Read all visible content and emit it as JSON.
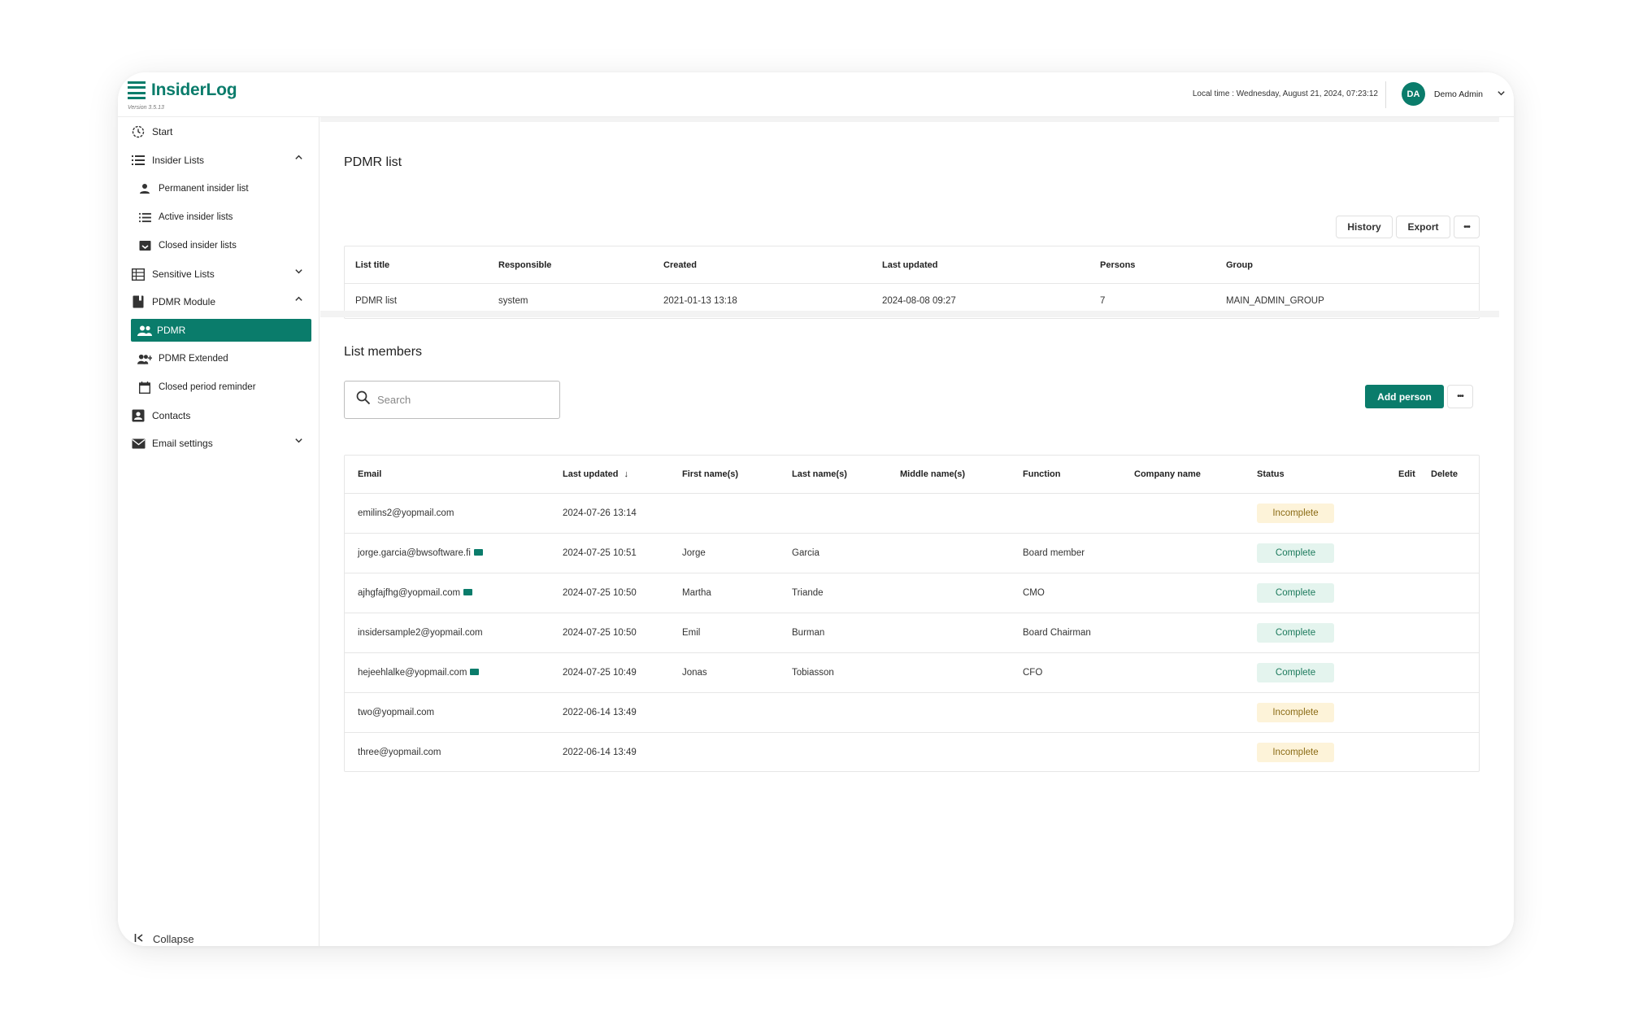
{
  "app": {
    "logo_text": "InsiderLog",
    "version": "Version 3.5.13",
    "local_time": "Local time : Wednesday, August 21, 2024, 07:23:12",
    "user_initials": "DA",
    "user_name": "Demo Admin"
  },
  "sidebar": {
    "start": "Start",
    "insider_lists": "Insider Lists",
    "permanent_insider_list": "Permanent insider list",
    "active_insider_lists": "Active insider lists",
    "closed_insider_lists": "Closed insider lists",
    "sensitive_lists": "Sensitive Lists",
    "pdmr_module": "PDMR Module",
    "pdmr": "PDMR",
    "pdmr_extended": "PDMR Extended",
    "closed_period_reminder": "Closed period reminder",
    "contacts": "Contacts",
    "email_settings": "Email settings",
    "collapse": "Collapse"
  },
  "list_info": {
    "title": "PDMR list",
    "history_label": "History",
    "export_label": "Export",
    "more_label": "•••",
    "headers": {
      "list_title": "List title",
      "responsible": "Responsible",
      "created": "Created",
      "last_updated": "Last updated",
      "persons": "Persons",
      "group": "Group"
    },
    "row": {
      "list_title": "PDMR list",
      "responsible": "system",
      "created": "2021-01-13 13:18",
      "last_updated": "2024-08-08 09:27",
      "persons": "7",
      "group": "MAIN_ADMIN_GROUP"
    }
  },
  "members": {
    "title": "List members",
    "search_placeholder": "Search",
    "add_person_label": "Add person",
    "more_label": "•••",
    "headers": {
      "email": "Email",
      "last_updated": "Last updated",
      "sort_arrow": "↓",
      "first_names": "First name(s)",
      "last_names": "Last name(s)",
      "middle_names": "Middle name(s)",
      "function": "Function",
      "company_name": "Company name",
      "status": "Status",
      "edit": "Edit",
      "delete": "Delete"
    },
    "rows": [
      {
        "email": "emilins2@yopmail.com",
        "mail_icon": false,
        "last_updated": "2024-07-26 13:14",
        "first": "",
        "last": "",
        "middle": "",
        "function": "",
        "company": "",
        "status": "Incomplete",
        "status_class": "incomplete"
      },
      {
        "email": "jorge.garcia@bwsoftware.fi",
        "mail_icon": true,
        "last_updated": "2024-07-25 10:51",
        "first": "Jorge",
        "last": "Garcia",
        "middle": "",
        "function": "Board member",
        "company": "",
        "status": "Complete",
        "status_class": "complete"
      },
      {
        "email": "ajhgfajfhg@yopmail.com",
        "mail_icon": true,
        "last_updated": "2024-07-25 10:50",
        "first": "Martha",
        "last": "Triande",
        "middle": "",
        "function": "CMO",
        "company": "",
        "status": "Complete",
        "status_class": "complete"
      },
      {
        "email": "insidersample2@yopmail.com",
        "mail_icon": false,
        "last_updated": "2024-07-25 10:50",
        "first": "Emil",
        "last": "Burman",
        "middle": "",
        "function": "Board Chairman",
        "company": "",
        "status": "Complete",
        "status_class": "complete"
      },
      {
        "email": "hejeehlalke@yopmail.com",
        "mail_icon": true,
        "last_updated": "2024-07-25 10:49",
        "first": "Jonas",
        "last": "Tobiasson",
        "middle": "",
        "function": "CFO",
        "company": "",
        "status": "Complete",
        "status_class": "complete"
      },
      {
        "email": "two@yopmail.com",
        "mail_icon": false,
        "last_updated": "2022-06-14 13:49",
        "first": "",
        "last": "",
        "middle": "",
        "function": "",
        "company": "",
        "status": "Incomplete",
        "status_class": "incomplete"
      },
      {
        "email": "three@yopmail.com",
        "mail_icon": false,
        "last_updated": "2022-06-14 13:49",
        "first": "",
        "last": "",
        "middle": "",
        "function": "",
        "company": "",
        "status": "Incomplete",
        "status_class": "incomplete"
      }
    ]
  },
  "colors": {
    "brand": "#0a7c6b",
    "incomplete_bg": "#fdf3d9",
    "complete_bg": "#e4f4ee"
  }
}
